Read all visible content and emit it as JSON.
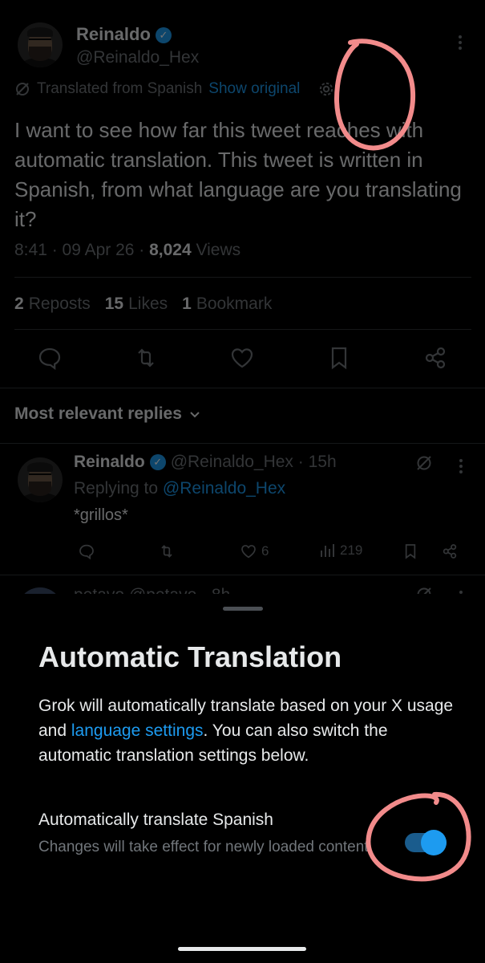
{
  "tweet": {
    "author_name": "Reinaldo",
    "author_handle": "@Reinaldo_Hex",
    "translated_label": "Translated from Spanish",
    "show_original": "Show original",
    "text": "I want to see how far this tweet reaches with automatic translation. This tweet is written in Spanish, from what language are you translating it?",
    "time": "8:41 · 09 Apr 26 · ",
    "views_count": "8,024",
    "views_label": " Views",
    "reposts_count": "2",
    "reposts_label": "Reposts",
    "likes_count": "15",
    "likes_label": "Likes",
    "bookmarks_count": "1",
    "bookmarks_label": "Bookmark"
  },
  "replies": {
    "header": "Most relevant replies",
    "items": [
      {
        "name": "Reinaldo",
        "handle_time": "@Reinaldo_Hex · 15h",
        "replying_prefix": "Replying to ",
        "replying_handle": "@Reinaldo_Hex",
        "text": "*grillos*",
        "likes": "6",
        "views": "219"
      },
      {
        "name_partial": "petavo @petavo · 8h"
      }
    ]
  },
  "sheet": {
    "title": "Automatic Translation",
    "desc_part1": "Grok will automatically translate based on your X usage and ",
    "desc_link": "language settings",
    "desc_part2": ". You can also switch the automatic translation settings below.",
    "option_title": "Automatically translate Spanish",
    "option_subtitle": "Changes will take effect for newly loaded content.",
    "toggle_on": true
  },
  "icons": {
    "translate": "translate-slash-icon",
    "gear": "gear-icon",
    "reply": "reply-icon",
    "repost": "repost-icon",
    "like": "heart-icon",
    "bookmark": "bookmark-icon",
    "share": "share-icon",
    "views": "views-icon"
  },
  "colors": {
    "accent": "#1d9bf0",
    "annotation": "#f28b8b"
  }
}
